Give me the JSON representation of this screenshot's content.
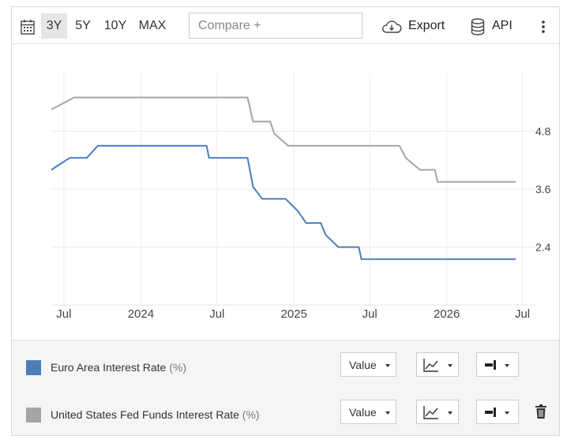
{
  "toolbar": {
    "ranges": [
      "3Y",
      "5Y",
      "10Y",
      "MAX"
    ],
    "active_range": "3Y",
    "compare_placeholder": "Compare +",
    "export_label": "Export",
    "api_label": "API",
    "icons": [
      "calendar-icon",
      "cloud-download-icon",
      "database-icon",
      "more-vertical-icon",
      "line-chart-icon",
      "bar-end-icon",
      "trash-icon"
    ]
  },
  "legend": {
    "series": [
      {
        "name": "Euro Area Interest Rate",
        "unit": "(%)",
        "color": "#4a7ebb",
        "value_label": "Value",
        "removable": false
      },
      {
        "name": "United States Fed Funds Interest Rate",
        "unit": "(%)",
        "color": "#a5a5a5",
        "value_label": "Value",
        "removable": true
      }
    ]
  },
  "chart_data": {
    "type": "line",
    "x_tick_labels": [
      "Jul",
      "2024",
      "Jul",
      "2025",
      "Jul",
      "2026",
      "Jul"
    ],
    "xlim": [
      "2023-06-01",
      "2026-08-01"
    ],
    "y_tick_labels": [
      "2.4",
      "3.6",
      "4.8"
    ],
    "y_ticks": [
      2.4,
      3.6,
      4.8
    ],
    "ylim": [
      1.2,
      6.0
    ],
    "y_axis_side": "right",
    "grid": true,
    "series": [
      {
        "name": "Euro Area Interest Rate",
        "color": "#4a7ebb",
        "points": [
          [
            "2023-06-01",
            4.0
          ],
          [
            "2023-07-15",
            4.25
          ],
          [
            "2023-08-25",
            4.25
          ],
          [
            "2023-09-20",
            4.5
          ],
          [
            "2024-06-06",
            4.5
          ],
          [
            "2024-06-12",
            4.25
          ],
          [
            "2024-09-12",
            4.25
          ],
          [
            "2024-09-25",
            3.65
          ],
          [
            "2024-10-17",
            3.4
          ],
          [
            "2024-12-12",
            3.4
          ],
          [
            "2025-01-10",
            3.15
          ],
          [
            "2025-01-30",
            2.9
          ],
          [
            "2025-03-06",
            2.9
          ],
          [
            "2025-03-18",
            2.65
          ],
          [
            "2025-04-17",
            2.4
          ],
          [
            "2025-06-05",
            2.4
          ],
          [
            "2025-06-11",
            2.15
          ],
          [
            "2026-06-15",
            2.15
          ]
        ]
      },
      {
        "name": "United States Fed Funds Interest Rate",
        "color": "#a5a5a5",
        "points": [
          [
            "2023-06-01",
            5.25
          ],
          [
            "2023-07-26",
            5.5
          ],
          [
            "2024-09-12",
            5.5
          ],
          [
            "2024-09-25",
            5.0
          ],
          [
            "2024-11-05",
            5.0
          ],
          [
            "2024-11-15",
            4.75
          ],
          [
            "2024-12-18",
            4.5
          ],
          [
            "2025-09-10",
            4.5
          ],
          [
            "2025-09-25",
            4.25
          ],
          [
            "2025-10-29",
            4.0
          ],
          [
            "2025-12-04",
            4.0
          ],
          [
            "2025-12-10",
            3.75
          ],
          [
            "2026-06-15",
            3.75
          ]
        ]
      }
    ]
  }
}
